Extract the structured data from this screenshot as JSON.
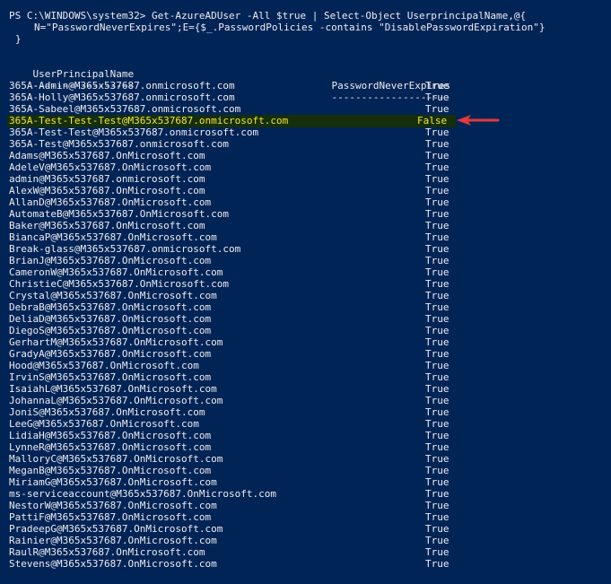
{
  "command": {
    "line1": "PS C:\\WINDOWS\\system32> Get-AzureADUser -All $true | Select-Object UserprincipalName,@{",
    "line2": "N=\"PasswordNeverExpires\";E={$_.PasswordPolicies -contains \"DisablePasswordExpiration\"}",
    "line3": "}"
  },
  "table": {
    "header": {
      "col1": "UserPrincipalName",
      "col2": "PasswordNeverExpires"
    },
    "separator": {
      "col1": "-----------------",
      "col2": "--------------------"
    },
    "rows": [
      {
        "upn": "365A-Admin@M365x537687.onmicrosoft.com",
        "value": "True"
      },
      {
        "upn": "365A-Holly@M365x537687.onmicrosoft.com",
        "value": "True"
      },
      {
        "upn": "365A-Sabeel@M365x537687.onmicrosoft.com",
        "value": "True"
      },
      {
        "upn": "365A-Test-Test-Test@M365x537687.onmicrosoft.com",
        "value": "False",
        "highlight": true
      },
      {
        "upn": "365A-Test-Test@M365x537687.onmicrosoft.com",
        "value": "True"
      },
      {
        "upn": "365A-Test@M365x537687.onmicrosoft.com",
        "value": "True"
      },
      {
        "upn": "Adams@M365x537687.OnMicrosoft.com",
        "value": "True"
      },
      {
        "upn": "AdeleV@M365x537687.OnMicrosoft.com",
        "value": "True"
      },
      {
        "upn": "admin@M365x537687.onmicrosoft.com",
        "value": "True"
      },
      {
        "upn": "AlexW@M365x537687.OnMicrosoft.com",
        "value": "True"
      },
      {
        "upn": "AllanD@M365x537687.OnMicrosoft.com",
        "value": "True"
      },
      {
        "upn": "AutomateB@M365x537687.OnMicrosoft.com",
        "value": "True"
      },
      {
        "upn": "Baker@M365x537687.OnMicrosoft.com",
        "value": "True"
      },
      {
        "upn": "BiancaP@M365x537687.OnMicrosoft.com",
        "value": "True"
      },
      {
        "upn": "Break-glass@M365x537687.onmicrosoft.com",
        "value": "True"
      },
      {
        "upn": "BrianJ@M365x537687.OnMicrosoft.com",
        "value": "True"
      },
      {
        "upn": "CameronW@M365x537687.OnMicrosoft.com",
        "value": "True"
      },
      {
        "upn": "ChristieC@M365x537687.OnMicrosoft.com",
        "value": "True"
      },
      {
        "upn": "Crystal@M365x537687.OnMicrosoft.com",
        "value": "True"
      },
      {
        "upn": "DebraB@M365x537687.OnMicrosoft.com",
        "value": "True"
      },
      {
        "upn": "DeliaD@M365x537687.OnMicrosoft.com",
        "value": "True"
      },
      {
        "upn": "DiegoS@M365x537687.OnMicrosoft.com",
        "value": "True"
      },
      {
        "upn": "GerhartM@M365x537687.OnMicrosoft.com",
        "value": "True"
      },
      {
        "upn": "GradyA@M365x537687.OnMicrosoft.com",
        "value": "True"
      },
      {
        "upn": "Hood@M365x537687.OnMicrosoft.com",
        "value": "True"
      },
      {
        "upn": "IrvinS@M365x537687.OnMicrosoft.com",
        "value": "True"
      },
      {
        "upn": "IsaiahL@M365x537687.OnMicrosoft.com",
        "value": "True"
      },
      {
        "upn": "JohannaL@M365x537687.OnMicrosoft.com",
        "value": "True"
      },
      {
        "upn": "JoniS@M365x537687.OnMicrosoft.com",
        "value": "True"
      },
      {
        "upn": "LeeG@M365x537687.OnMicrosoft.com",
        "value": "True"
      },
      {
        "upn": "LidiaH@M365x537687.OnMicrosoft.com",
        "value": "True"
      },
      {
        "upn": "LynneR@M365x537687.OnMicrosoft.com",
        "value": "True"
      },
      {
        "upn": "MalloryC@M365x537687.OnMicrosoft.com",
        "value": "True"
      },
      {
        "upn": "MeganB@M365x537687.OnMicrosoft.com",
        "value": "True"
      },
      {
        "upn": "MiriamG@M365x537687.OnMicrosoft.com",
        "value": "True"
      },
      {
        "upn": "ms-serviceaccount@M365x537687.OnMicrosoft.com",
        "value": "True"
      },
      {
        "upn": "NestorW@M365x537687.OnMicrosoft.com",
        "value": "True"
      },
      {
        "upn": "PattiF@M365x537687.OnMicrosoft.com",
        "value": "True"
      },
      {
        "upn": "PradeepG@M365x537687.OnMicrosoft.com",
        "value": "True"
      },
      {
        "upn": "Rainier@M365x537687.OnMicrosoft.com",
        "value": "True"
      },
      {
        "upn": "RaulR@M365x537687.OnMicrosoft.com",
        "value": "True"
      },
      {
        "upn": "Stevens@M365x537687.OnMicrosoft.com",
        "value": "True"
      }
    ]
  },
  "colors": {
    "background": "#012456",
    "text": "#eeedf0",
    "highlight_text": "#f5e832",
    "highlight_row": "#152e0c",
    "arrow": "#e23b3b"
  },
  "annotation": {
    "icon": "red-arrow-icon"
  }
}
